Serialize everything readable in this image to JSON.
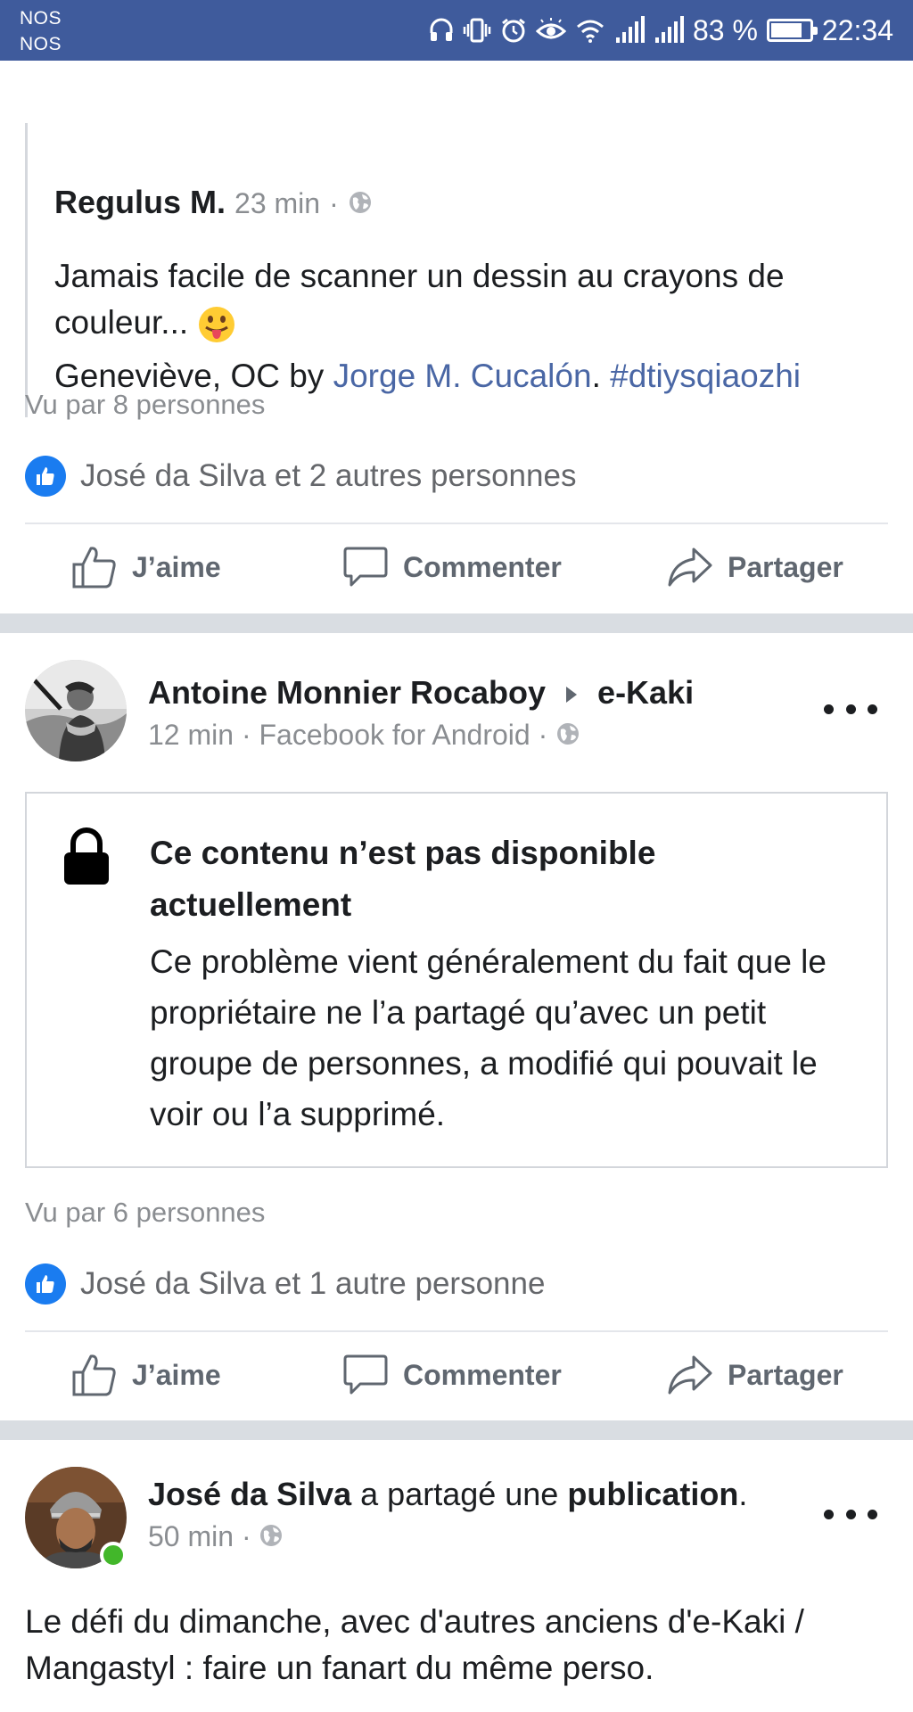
{
  "status_bar": {
    "carrier_1": "NOS",
    "carrier_2": "NOS",
    "battery_text": "83 %",
    "battery_level": 0.83,
    "time": "22:34",
    "icons": [
      "headset-icon",
      "vibrate-icon",
      "alarm-icon",
      "eye-icon",
      "wifi-icon",
      "signal-icon",
      "signal-icon"
    ],
    "color": "#3f5b9c"
  },
  "post1": {
    "shared": {
      "author": "Regulus M.",
      "time": "23 min",
      "dot": "·",
      "text_line1": "Jamais facile de scanner un dessin au crayons de",
      "text_line2": "couleur...",
      "caption_prefix": "Geneviève, OC by ",
      "caption_link": "Jorge M. Cucalón",
      "caption_period": ". ",
      "caption_hashtag": "#dtiysqiaozhi"
    },
    "seen": "Vu par 8 personnes",
    "likes": "José da Silva et 2 autres personnes"
  },
  "post2": {
    "author": "Antoine Monnier Rocaboy",
    "group": "e-Kaki",
    "time": "12 min",
    "dot": "·",
    "source": "Facebook for Android",
    "unavailable_title": "Ce contenu n’est pas disponible actuellement",
    "unavailable_body": "Ce problème vient généralement du fait que le propriétaire ne l’a partagé qu’avec un petit groupe de personnes, a modifié qui pouvait le voir ou l’a supprimé.",
    "seen": "Vu par 6 personnes",
    "likes": "José da Silva et 1 autre personne"
  },
  "post3": {
    "author": "José da Silva",
    "verb": " a partagé une ",
    "object": "publication",
    "period": ".",
    "time": "50 min",
    "dot": "·",
    "text": "Le défi du dimanche, avec d'autres anciens d'e-Kaki / Mangastyl : faire un fanart du même perso."
  },
  "actions": {
    "like": "J’aime",
    "comment": "Commenter",
    "share": "Partager"
  },
  "colors": {
    "link": "#4a67a5",
    "like_badge": "#1a7cf0",
    "online": "#42b72a",
    "separator": "#d9dde2"
  }
}
